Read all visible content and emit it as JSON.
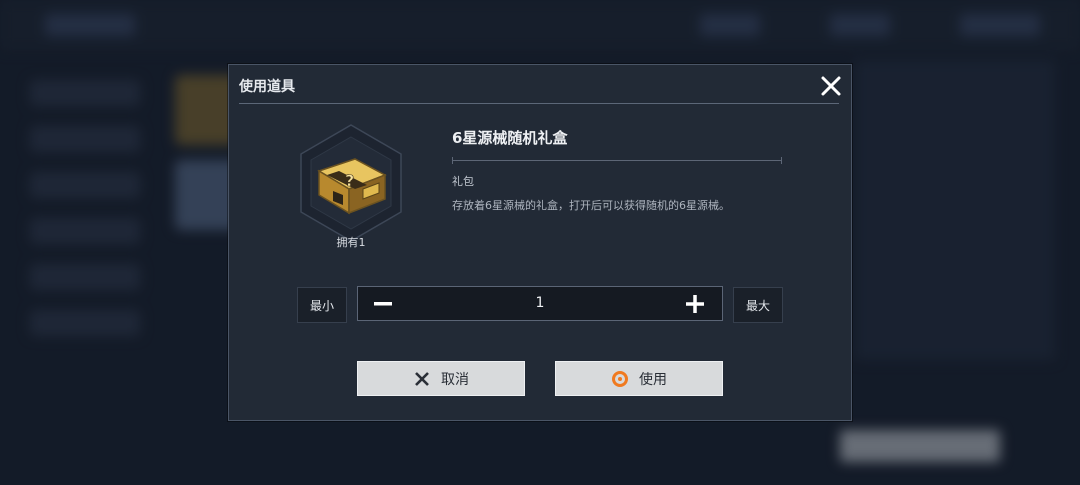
{
  "dialog": {
    "title": "使用道具",
    "close_icon": "close-icon"
  },
  "item": {
    "name": "6星源械随机礼盒",
    "type": "礼包",
    "description": "存放着6星源械的礼盒，打开后可以获得随机的6星源械。",
    "owned_label": "拥有1",
    "icon": "gift-box-icon"
  },
  "quantity": {
    "min_label": "最小",
    "max_label": "最大",
    "value": "1",
    "decrement_icon": "minus-icon",
    "increment_icon": "plus-icon"
  },
  "actions": {
    "cancel_label": "取消",
    "use_label": "使用",
    "cancel_icon": "x-icon",
    "use_icon": "orange-ring-icon"
  },
  "colors": {
    "dialog_bg": "#222a36",
    "accent_orange": "#f07a20",
    "button_bg": "#d8dadc"
  }
}
